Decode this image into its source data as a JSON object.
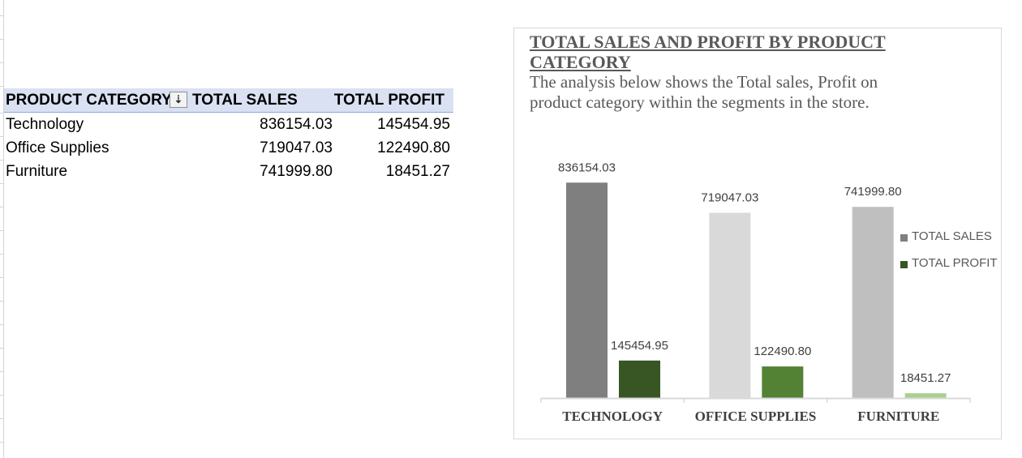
{
  "pivot": {
    "headers": {
      "category": "PRODUCT CATEGORY",
      "sales": "TOTAL SALES",
      "profit": "TOTAL PROFIT"
    },
    "filter_icon": "sort-descending-filter-icon",
    "rows": [
      {
        "category": "Technology",
        "sales": "836154.03",
        "profit": "145454.95"
      },
      {
        "category": "Office Supplies",
        "sales": "719047.03",
        "profit": "122490.80"
      },
      {
        "category": "Furniture",
        "sales": "741999.80",
        "profit": "18451.27"
      }
    ]
  },
  "chart": {
    "title": "TOTAL SALES AND PROFIT BY PRODUCT CATEGORY",
    "subtitle": "The analysis below shows the Total sales, Profit on product category within the segments in the store."
  },
  "chart_data": {
    "type": "bar",
    "categories": [
      "TECHNOLOGY",
      "OFFICE SUPPLIES",
      "FURNITURE"
    ],
    "series": [
      {
        "name": "TOTAL SALES",
        "values": [
          836154.03,
          719047.03,
          741999.8
        ],
        "labels": [
          "836154.03",
          "719047.03",
          "741999.80"
        ],
        "colors": [
          "#7f7f7f",
          "#d9d9d9",
          "#bfbfbf"
        ]
      },
      {
        "name": "TOTAL PROFIT",
        "values": [
          145454.95,
          122490.8,
          18451.27
        ],
        "labels": [
          "145454.95",
          "122490.80",
          "18451.27"
        ],
        "colors": [
          "#375623",
          "#548235",
          "#a9d18e"
        ]
      }
    ],
    "ylim": [
      0,
      900000
    ],
    "legend_colors": [
      "#7f7f7f",
      "#375623"
    ],
    "legend_position": "right",
    "grid": false
  }
}
